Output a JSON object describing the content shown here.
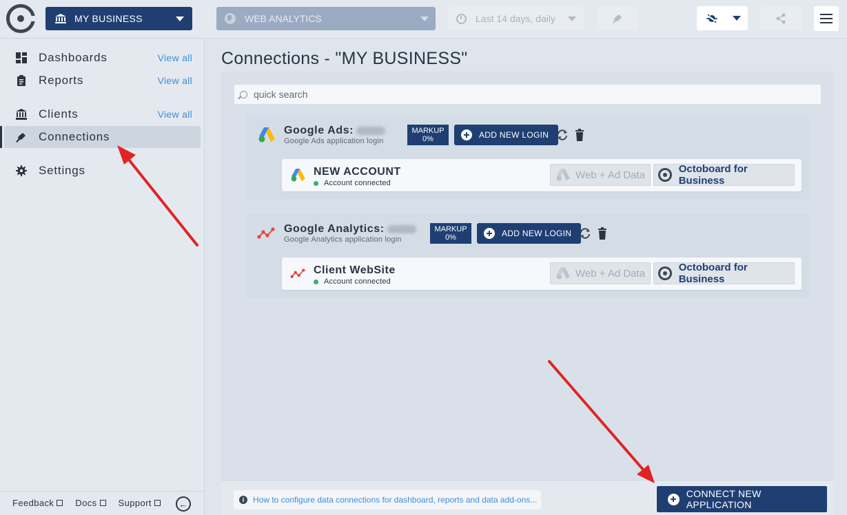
{
  "topbar": {
    "business": "MY BUSINESS",
    "app_select": "WEB ANALYTICS",
    "date_range": "Last 14 days, daily"
  },
  "sidebar": {
    "items": [
      {
        "label": "Dashboards",
        "view_all": "View all",
        "icon": "dashboard-grid-icon"
      },
      {
        "label": "Reports",
        "view_all": "View all",
        "icon": "clipboard-icon"
      },
      {
        "label": "Clients",
        "view_all": "View all",
        "icon": "bank-icon"
      },
      {
        "label": "Connections",
        "icon": "plug-icon",
        "active": true
      },
      {
        "label": "Settings",
        "icon": "gear-icon"
      }
    ],
    "footer": {
      "feedback": "Feedback",
      "docs": "Docs",
      "support": "Support"
    }
  },
  "main": {
    "title": "Connections - \"MY BUSINESS\"",
    "search_placeholder": "quick search",
    "groups": [
      {
        "app": "Google Ads:",
        "subtitle": "Google Ads application login",
        "markup_label": "MARKUP",
        "markup_value": "0%",
        "add_login": "ADD NEW LOGIN",
        "account": {
          "name": "NEW ACCOUNT",
          "status": "Account connected",
          "web_ad": "Web + Ad Data",
          "octoboard": "Octoboard for Business"
        }
      },
      {
        "app": "Google Analytics:",
        "subtitle": "Google Analytics application login",
        "markup_label": "MARKUP",
        "markup_value": "0%",
        "add_login": "ADD NEW LOGIN",
        "account": {
          "name": "Client WebSite",
          "status": "Account connected",
          "web_ad": "Web + Ad Data",
          "octoboard": "Octoboard for Business"
        }
      }
    ],
    "help_link": "How to configure data connections for dashboard, reports and data add-ons...",
    "connect_button": "CONNECT NEW APPLICATION"
  },
  "colors": {
    "brand": "#1f3f73",
    "link": "#3d8fd8",
    "status_ok": "#35b36b",
    "annotation_arrow": "#e02424"
  }
}
